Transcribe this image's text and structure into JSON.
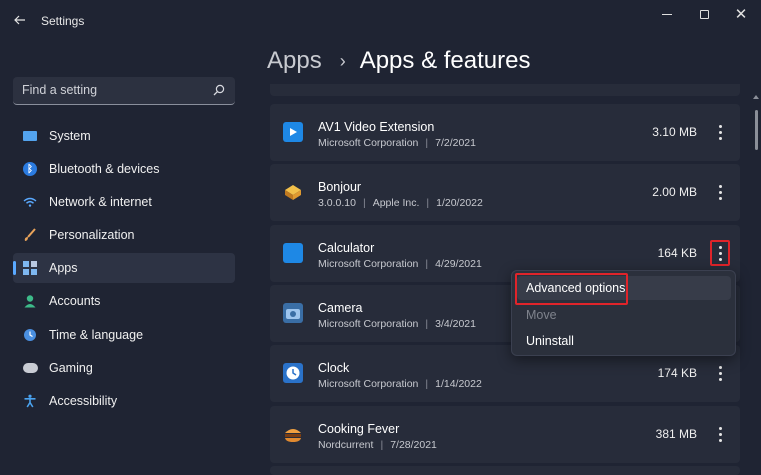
{
  "window": {
    "title": "Settings",
    "controls": {
      "minimize": "minimize",
      "maximize": "maximize",
      "close": "✕"
    }
  },
  "search": {
    "placeholder": "Find a setting"
  },
  "sidebar": {
    "items": [
      {
        "label": "System",
        "icon": "system-icon"
      },
      {
        "label": "Bluetooth & devices",
        "icon": "bluetooth-icon"
      },
      {
        "label": "Network & internet",
        "icon": "wifi-icon"
      },
      {
        "label": "Personalization",
        "icon": "brush-icon"
      },
      {
        "label": "Apps",
        "icon": "apps-icon",
        "selected": true
      },
      {
        "label": "Accounts",
        "icon": "person-icon"
      },
      {
        "label": "Time & language",
        "icon": "globe-clock-icon"
      },
      {
        "label": "Gaming",
        "icon": "gamepad-icon"
      },
      {
        "label": "Accessibility",
        "icon": "accessibility-icon"
      }
    ]
  },
  "breadcrumb": {
    "parent": "Apps",
    "separator": "›",
    "current": "Apps & features"
  },
  "apps": [
    {
      "name": "AV1 Video Extension",
      "publisher": "Microsoft Corporation",
      "date": "7/2/2021",
      "size": "3.10 MB",
      "icon_color": "#1e88e5"
    },
    {
      "name": "Bonjour",
      "publisher": "3.0.0.10",
      "publisher2": "Apple Inc.",
      "date": "1/20/2022",
      "size": "2.00 MB",
      "icon_color": "#e0a030"
    },
    {
      "name": "Calculator",
      "publisher": "Microsoft Corporation",
      "date": "4/29/2021",
      "size": "164 KB",
      "icon_color": "#1e88e5"
    },
    {
      "name": "Camera",
      "publisher": "Microsoft Corporation",
      "date": "3/4/2021",
      "size": "",
      "icon_color": "#3a6ea5"
    },
    {
      "name": "Clock",
      "publisher": "Microsoft Corporation",
      "date": "1/14/2022",
      "size": "174 KB",
      "icon_color": "#2a72c9"
    },
    {
      "name": "Cooking Fever",
      "publisher": "Nordcurrent",
      "date": "7/28/2021",
      "size": "381 MB",
      "icon_color": "#f0a040"
    }
  ],
  "context_menu": {
    "items": [
      {
        "label": "Advanced options",
        "enabled": true
      },
      {
        "label": "Move",
        "enabled": false
      },
      {
        "label": "Uninstall",
        "enabled": true
      }
    ]
  },
  "colors": {
    "background": "#1f2433",
    "card": "#272c3a",
    "accent": "#5aa9ff",
    "highlight": "#e0242a"
  }
}
